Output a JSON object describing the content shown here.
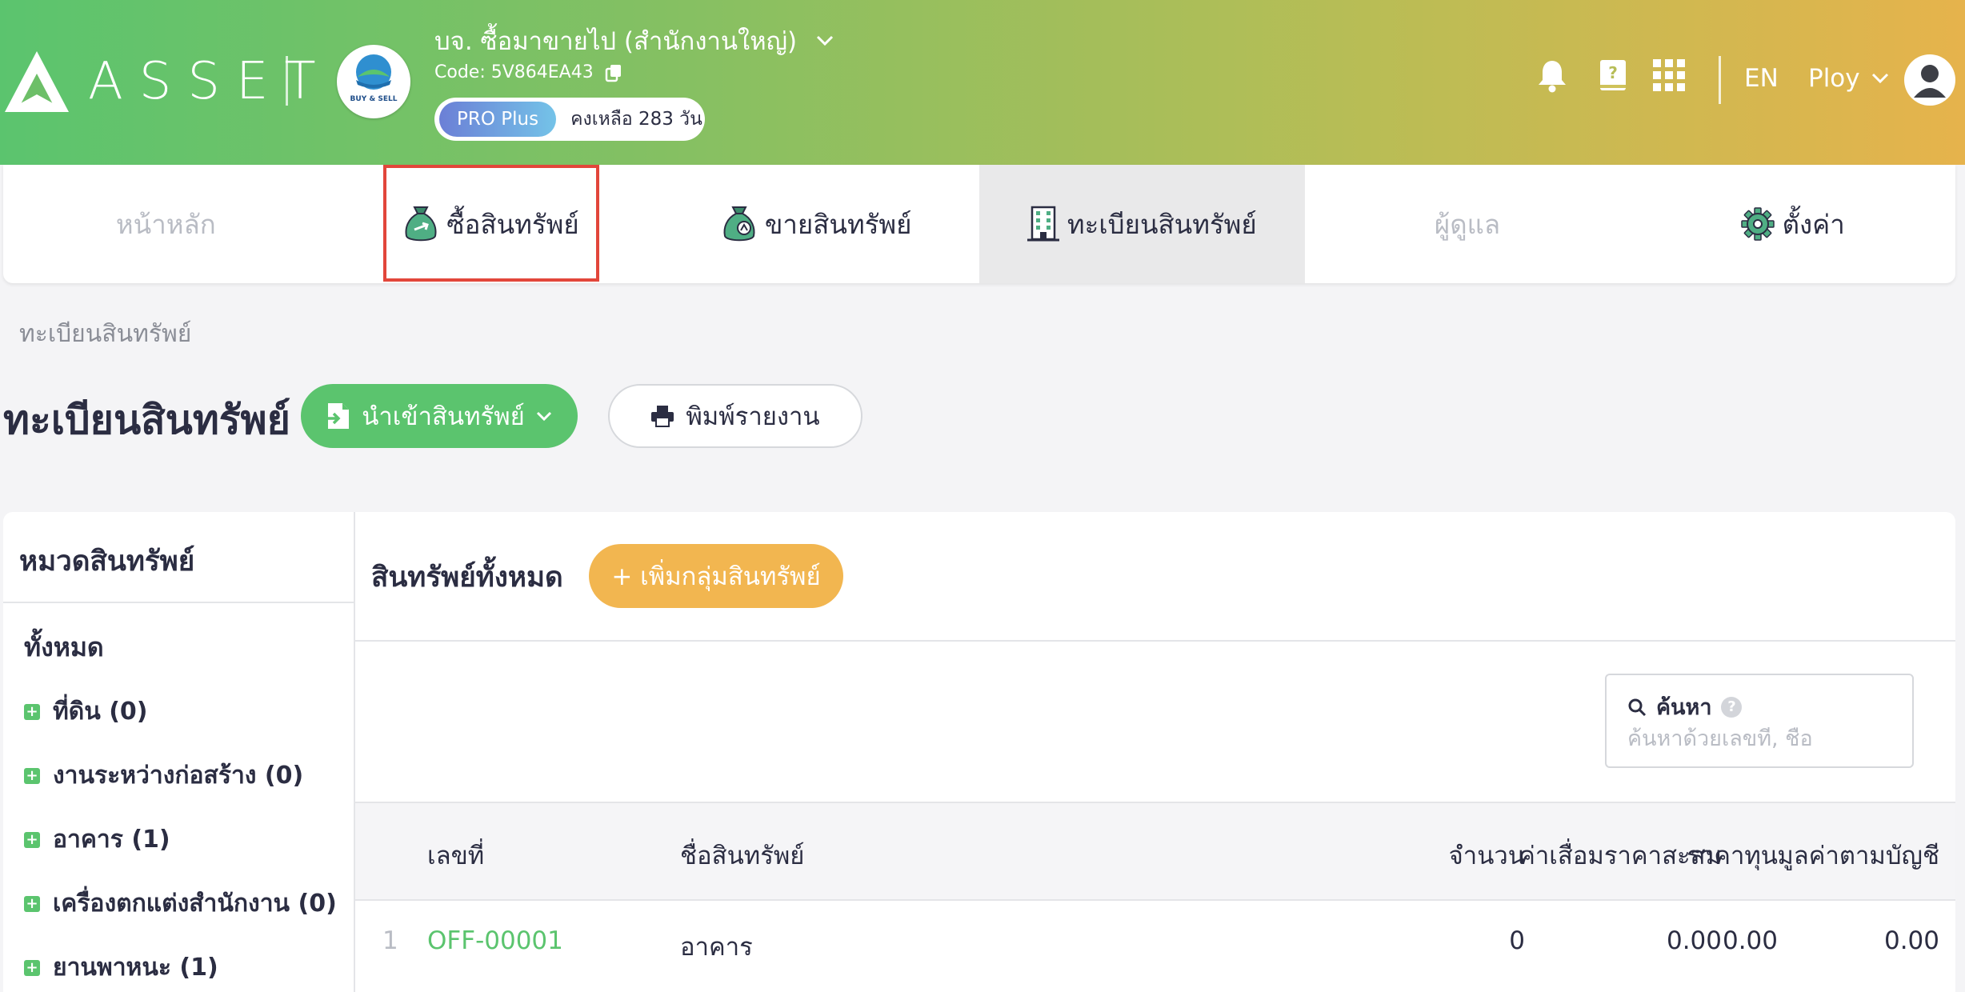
{
  "header": {
    "logo_text": "ASSET",
    "company_name": "บจ. ซื้อมาขายไป (สำนักงานใหญ่)",
    "company_code": "Code: 5V864EA43",
    "company_logo_text": "BUY & SELL",
    "plan_badge": "PRO Plus",
    "plan_remaining": "คงเหลือ 283 วัน",
    "language": "EN",
    "user_name": "Ploy"
  },
  "tabs": [
    {
      "label": "หน้าหลัก"
    },
    {
      "label": "ซื้อสินทรัพย์"
    },
    {
      "label": "ขายสินทรัพย์"
    },
    {
      "label": "ทะเบียนสินทรัพย์"
    },
    {
      "label": "ผู้ดูแล"
    },
    {
      "label": "ตั้งค่า"
    }
  ],
  "breadcrumb": "ทะเบียนสินทรัพย์",
  "page_title": "ทะเบียนสินทรัพย์",
  "actions": {
    "import_label": "นำเข้าสินทรัพย์",
    "print_label": "พิมพ์รายงาน"
  },
  "categories": {
    "title": "หมวดสินทรัพย์",
    "all_label": "ทั้งหมด",
    "items": [
      {
        "label": "ที่ดิน (0)"
      },
      {
        "label": "งานระหว่างก่อสร้าง (0)"
      },
      {
        "label": "อาคาร (1)"
      },
      {
        "label": "เครื่องตกแต่งสำนักงาน (0)"
      },
      {
        "label": "ยานพาหนะ (1)"
      }
    ]
  },
  "main": {
    "title": "สินทรัพย์ทั้งหมด",
    "add_group_label": "+ เพิ่มกลุ่มสินทรัพย์"
  },
  "search": {
    "label": "ค้นหา",
    "placeholder": "ค้นหาด้วยเลขที่, ชื่อ"
  },
  "table": {
    "headers": {
      "number": "เลขที่",
      "name": "ชื่อสินทรัพย์",
      "quantity": "จำนวน",
      "cost": "ราคาทุน",
      "depreciation": "ค่าเสื่อมราคาสะสม",
      "book_value": "มูลค่าตามบัญชี"
    },
    "rows": [
      {
        "index": "1",
        "number": "OFF-00001",
        "name": "อาคาร",
        "quantity": "0",
        "cost": "0.00",
        "depreciation": "0.00",
        "book_value": "0.00"
      }
    ]
  },
  "colors": {
    "accent_green": "#5bc46e",
    "accent_orange": "#f2b650",
    "highlight_red": "#e2463b"
  }
}
